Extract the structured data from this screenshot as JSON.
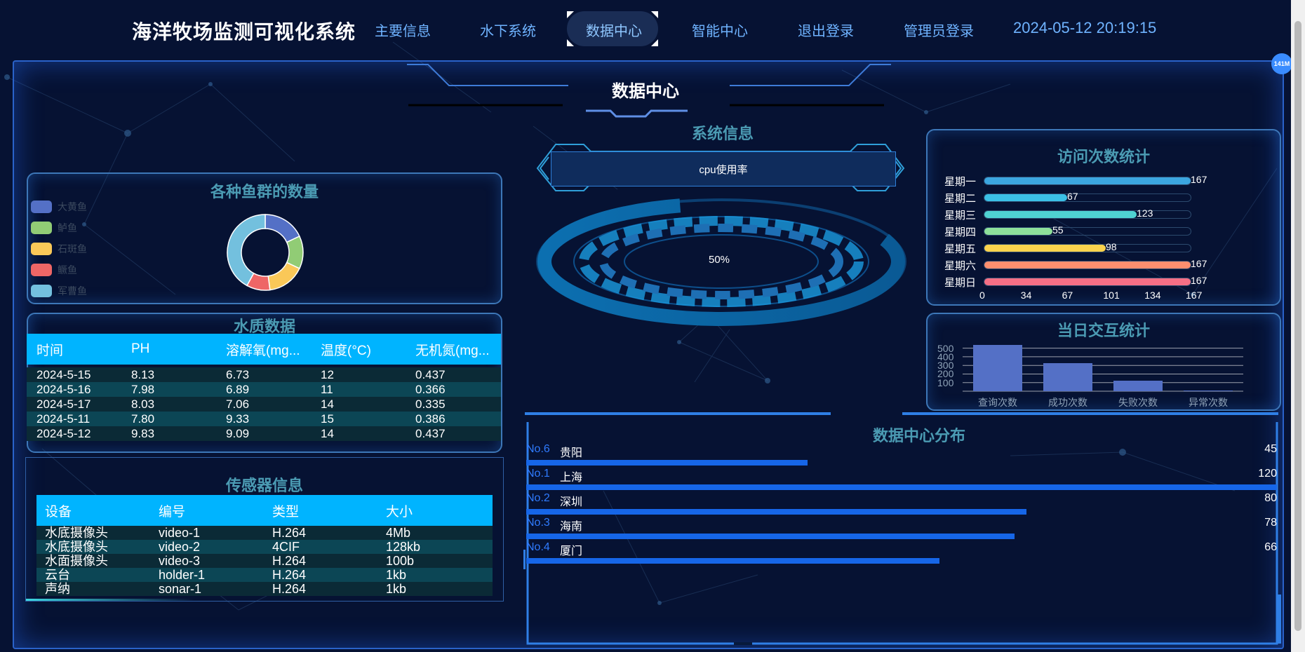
{
  "header": {
    "app_title": "海洋牧场监测可视化系统",
    "nav": [
      "主要信息",
      "水下系统",
      "数据中心",
      "智能中心",
      "退出登录",
      "管理员登录"
    ],
    "active_nav": "数据中心",
    "datetime": "2024-05-12 20:19:15"
  },
  "badge": "141M",
  "page_title": "数据中心",
  "fish_panel": {
    "title": "各种鱼群的数量",
    "legend": [
      {
        "name": "大黄鱼",
        "color": "#5470c6"
      },
      {
        "name": "鲈鱼",
        "color": "#91cc75"
      },
      {
        "name": "石斑鱼",
        "color": "#fac858"
      },
      {
        "name": "鳜鱼",
        "color": "#ee6666"
      },
      {
        "name": "军曹鱼",
        "color": "#73c0de"
      }
    ]
  },
  "chart_data": [
    {
      "type": "pie",
      "title": "各种鱼群的数量",
      "categories": [
        "大黄鱼",
        "鲈鱼",
        "石斑鱼",
        "鳜鱼",
        "军曹鱼"
      ],
      "values": [
        18,
        14,
        16,
        10,
        42
      ]
    },
    {
      "type": "bar",
      "title": "访问次数统计",
      "categories": [
        "星期一",
        "星期二",
        "星期三",
        "星期四",
        "星期五",
        "星期六",
        "星期日"
      ],
      "values": [
        167,
        67,
        123,
        55,
        98,
        167,
        167
      ],
      "xlim": [
        0,
        167
      ],
      "x_ticks": [
        "0",
        "34",
        "67",
        "101",
        "134",
        "167"
      ],
      "colors": [
        "#3ba6e0",
        "#3bc0e6",
        "#4fd2d2",
        "#8ee09a",
        "#fcd34d",
        "#fd8f6f",
        "#f56f85"
      ]
    },
    {
      "type": "bar",
      "title": "当日交互统计",
      "categories": [
        "查询次数",
        "成功次数",
        "失败次数",
        "异常次数"
      ],
      "values": [
        540,
        330,
        120,
        8
      ],
      "ylim": [
        0,
        600
      ],
      "y_ticks": [
        "100",
        "200",
        "300",
        "400",
        "500"
      ]
    }
  ],
  "water_quality": {
    "title": "水质数据",
    "columns": [
      "时间",
      "PH",
      "溶解氧(mg...",
      "温度(°C)",
      "无机氮(mg..."
    ],
    "rows": [
      [
        "2024-5-15",
        "8.13",
        "6.73",
        "12",
        "0.437"
      ],
      [
        "2024-5-16",
        "7.98",
        "6.89",
        "11",
        "0.366"
      ],
      [
        "2024-5-17",
        "8.03",
        "7.06",
        "14",
        "0.335"
      ],
      [
        "2024-5-11",
        "7.80",
        "9.33",
        "15",
        "0.386"
      ],
      [
        "2024-5-12",
        "9.83",
        "9.09",
        "14",
        "0.437"
      ]
    ]
  },
  "sensors": {
    "title": "传感器信息",
    "columns": [
      "设备",
      "编号",
      "类型",
      "大小"
    ],
    "rows": [
      [
        "水底摄像头",
        "video-1",
        "H.264",
        "4Mb"
      ],
      [
        "水底摄像头",
        "video-2",
        "4CIF",
        "128kb"
      ],
      [
        "水面摄像头",
        "video-3",
        "H.264",
        "100b"
      ],
      [
        "云台",
        "holder-1",
        "H.264",
        "1kb"
      ],
      [
        "声纳",
        "sonar-1",
        "H.264",
        "1kb"
      ]
    ]
  },
  "system": {
    "title": "系统信息",
    "cpu_label": "cpu使用率",
    "cpu_percent": "50%"
  },
  "visits": {
    "title": "访问次数统计"
  },
  "interaction": {
    "title": "当日交互统计"
  },
  "distribution": {
    "title": "数据中心分布",
    "max": 120,
    "rows": [
      {
        "no": "No.6",
        "city": "贵阳",
        "value": 45
      },
      {
        "no": "No.1",
        "city": "上海",
        "value": 120
      },
      {
        "no": "No.2",
        "city": "深圳",
        "value": 80
      },
      {
        "no": "No.3",
        "city": "海南",
        "value": 78
      },
      {
        "no": "No.4",
        "city": "厦门",
        "value": 66
      }
    ]
  }
}
